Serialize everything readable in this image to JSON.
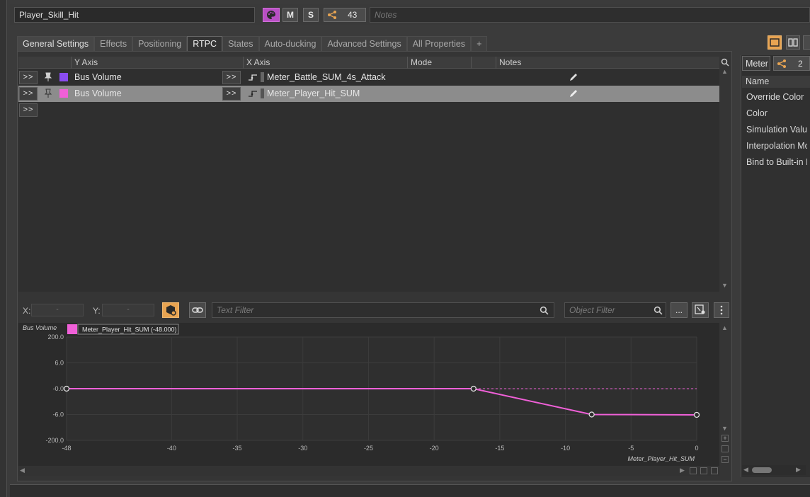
{
  "header": {
    "object_name": "Player_Skill_Hit",
    "m_label": "M",
    "s_label": "S",
    "reference_count": "43",
    "notes_placeholder": "Notes"
  },
  "tabs": [
    {
      "label": "General Settings"
    },
    {
      "label": "Effects"
    },
    {
      "label": "Positioning"
    },
    {
      "label": "RTPC"
    },
    {
      "label": "States"
    },
    {
      "label": "Auto-ducking"
    },
    {
      "label": "Advanced Settings"
    },
    {
      "label": "All Properties"
    },
    {
      "label": "+"
    }
  ],
  "rtpc_table": {
    "columns": {
      "y_axis": "Y Axis",
      "x_axis": "X Axis",
      "mode": "Mode",
      "notes": "Notes"
    },
    "expand_label": ">>",
    "rows": [
      {
        "y_axis": "Bus Volume",
        "color": "#8a4cf0",
        "x_axis": "Meter_Battle_SUM_4s_Attack",
        "selected": false
      },
      {
        "y_axis": "Bus Volume",
        "color": "#f060d8",
        "x_axis": "Meter_Player_Hit_SUM",
        "selected": true
      }
    ]
  },
  "filter_bar": {
    "x_label": "X:",
    "y_label": "Y:",
    "x_value": "-",
    "y_value": "-",
    "text_filter_placeholder": "Text Filter",
    "object_filter_placeholder": "Object Filter",
    "more_label": "..."
  },
  "chart_data": {
    "type": "line",
    "ylabel": "Bus Volume",
    "xlabel": "Meter_Player_Hit_SUM",
    "legend": {
      "label": "Meter_Player_Hit_SUM (-48.000)",
      "color": "#f060d8",
      "placement": "top-left"
    },
    "xlim": [
      -48,
      0
    ],
    "x_ticks": [
      "-48",
      "-40",
      "-35",
      "-30",
      "-25",
      "-20",
      "-15",
      "-10",
      "-5",
      "0"
    ],
    "y_ticks": [
      "200.0",
      "6.0",
      "-0.0",
      "-6.0",
      "-200.0"
    ],
    "series": [
      {
        "x": [
          -48,
          -17,
          -8,
          0
        ],
        "y": [
          0,
          0,
          -6,
          -8.4
        ]
      }
    ],
    "grid": true
  },
  "right_panel": {
    "tab_label": "Meter",
    "reference_count": "2",
    "header": "Name",
    "items": [
      "Override Color",
      "Color",
      "Simulation Value",
      "Interpolation Mode",
      "Bind to Built-in Parameter"
    ]
  }
}
